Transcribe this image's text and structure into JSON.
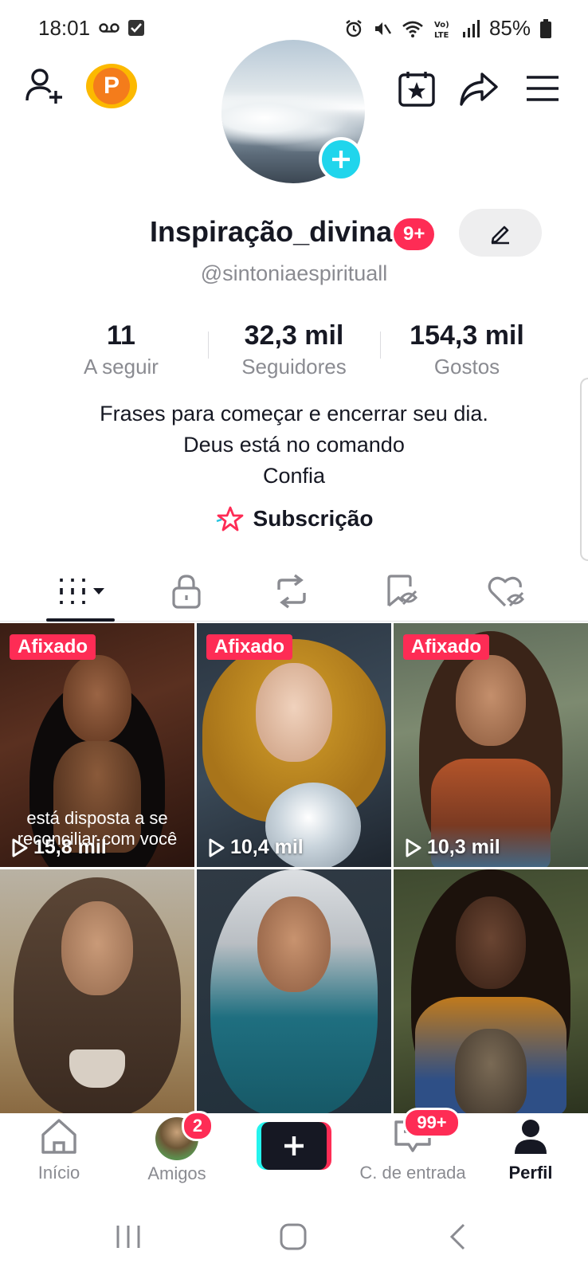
{
  "status_bar": {
    "time": "18:01",
    "battery": "85%",
    "icons": [
      "voicemail-icon",
      "checkbox-icon",
      "alarm-icon",
      "mute-icon",
      "wifi-icon",
      "volte-icon",
      "signal-icon",
      "battery-icon"
    ]
  },
  "header": {
    "icons": [
      "add-friend-icon",
      "premium-p-icon",
      "calendar-star-icon",
      "share-icon",
      "menu-icon"
    ],
    "premium_letter": "P"
  },
  "profile": {
    "name": "Inspiração_divina",
    "notif_badge": "9+",
    "handle": "@sintoniaespirituall",
    "stats": [
      {
        "value": "11",
        "label": "A seguir"
      },
      {
        "value": "32,3 mil",
        "label": "Seguidores"
      },
      {
        "value": "154,3 mil",
        "label": "Gostos"
      }
    ],
    "bio_lines": [
      "Frases para começar e encerrar seu dia.",
      "Deus está no comando",
      "Confia"
    ],
    "subscription_label": "Subscrição"
  },
  "tabs": [
    "videos-grid-tab",
    "private-tab",
    "reposts-tab",
    "favorites-tab",
    "liked-tab"
  ],
  "videos": [
    {
      "pinned": "Afixado",
      "views": "15,8 mil",
      "overlay": "está disposta a se reconciliar com você"
    },
    {
      "pinned": "Afixado",
      "views": "10,4 mil"
    },
    {
      "pinned": "Afixado",
      "views": "10,3 mil"
    },
    {},
    {},
    {}
  ],
  "bottom_nav": {
    "home": "Início",
    "friends": "Amigos",
    "friends_badge": "2",
    "inbox": "C. de entrada",
    "inbox_badge": "99+",
    "profile": "Perfil"
  },
  "colors": {
    "accent": "#fe2c55",
    "cyan": "#25f4ee",
    "text": "#161823",
    "muted": "#8a8b91"
  }
}
